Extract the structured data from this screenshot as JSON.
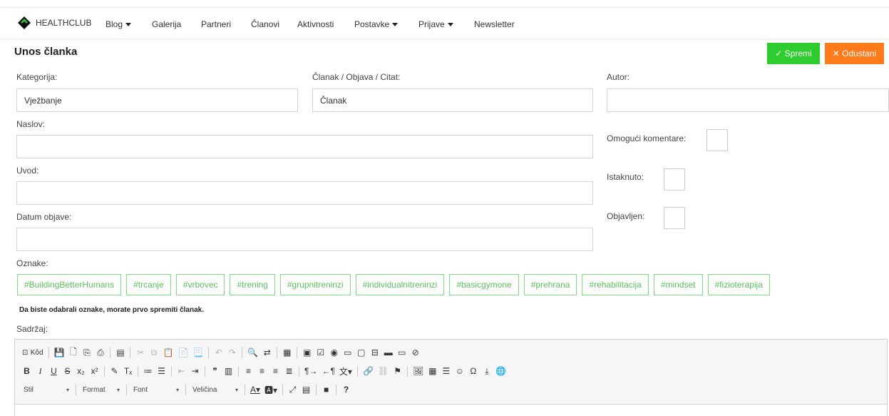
{
  "navbar": {
    "brand": "HEALTHCLUB",
    "items": [
      {
        "label": "Blog",
        "dropdown": true
      },
      {
        "label": "Galerija",
        "dropdown": false
      },
      {
        "label": "Partneri",
        "dropdown": false
      },
      {
        "label": "Članovi",
        "dropdown": false
      },
      {
        "label": "Aktivnosti",
        "dropdown": false
      },
      {
        "label": "Postavke",
        "dropdown": true
      },
      {
        "label": "Prijave",
        "dropdown": true
      },
      {
        "label": "Newsletter",
        "dropdown": false
      }
    ]
  },
  "page": {
    "title": "Unos članka",
    "save_label": "✓ Spremi",
    "cancel_label": "✕ Odustani"
  },
  "form": {
    "kategorija_label": "Kategorija:",
    "kategorija_value": "Vježbanje",
    "vrsta_label": "Članak / Objava / Citat:",
    "vrsta_value": "Članak",
    "autor_label": "Autor:",
    "autor_value": "",
    "naslov_label": "Naslov:",
    "naslov_value": "",
    "uvod_label": "Uvod:",
    "uvod_value": "",
    "datum_label": "Datum objave:",
    "datum_value": "",
    "komentari_label": "Omogući komentare:",
    "istaknuto_label": "Istaknuto:",
    "objavljen_label": "Objavljen:",
    "oznake_label": "Oznake:",
    "tags": [
      "#BuildingBetterHumans",
      "#trcanje",
      "#vrbovec",
      "#trening",
      "#grupnitreninzi",
      "#individualnitreninzi",
      "#basicgymone",
      "#prehrana",
      "#rehabilitacija",
      "#mindset",
      "#fizioterapija"
    ],
    "tags_note": "Da biste odabrali oznake, morate prvo spremiti članak.",
    "sadrzaj_label": "Sadržaj:"
  },
  "editor": {
    "source_label": "Kôd",
    "combo_style": "Stil",
    "combo_format": "Format",
    "combo_font": "Font",
    "combo_size": "Veličina"
  },
  "colors": {
    "save": "#2ecc2e",
    "cancel": "#ff7a1a",
    "tag_border": "#7ddd7d",
    "tag_text": "#5cbf5c"
  }
}
